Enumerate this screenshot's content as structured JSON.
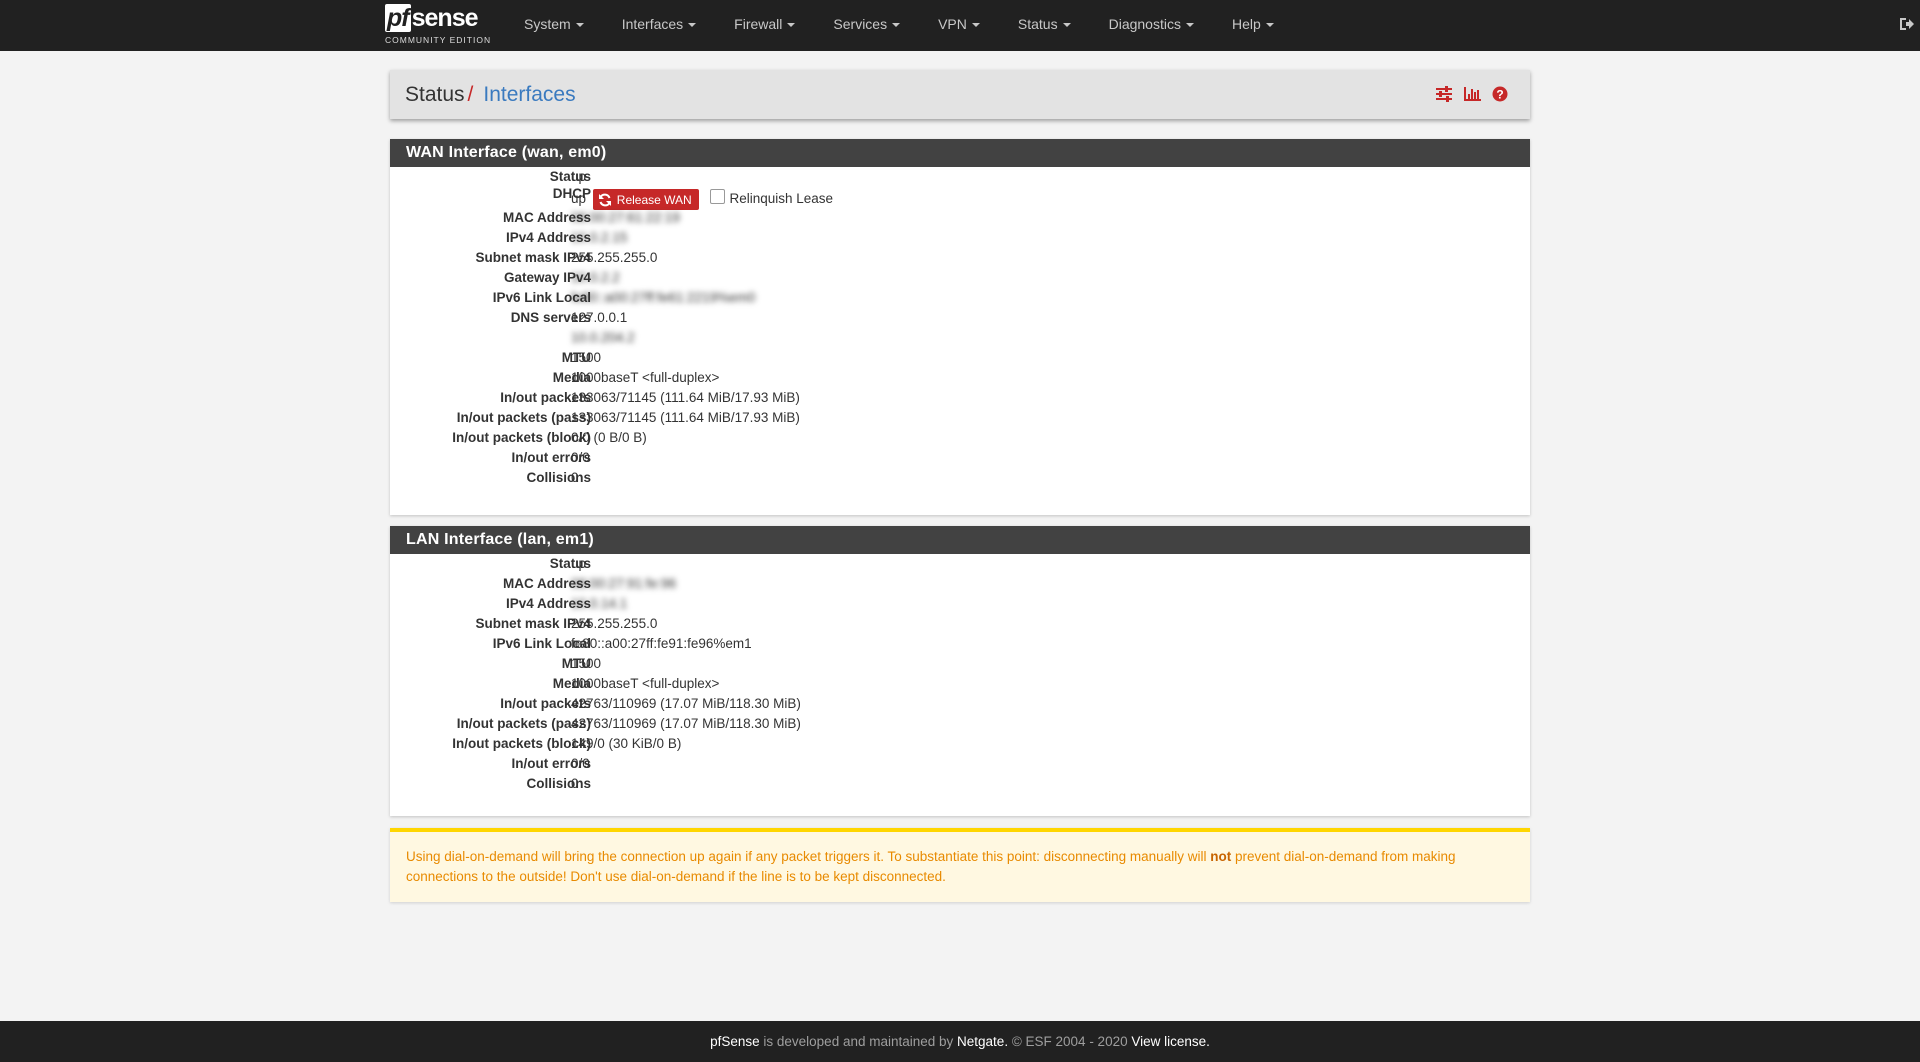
{
  "navbar": {
    "brand": {
      "logo_pf": "pf",
      "logo_sense": "sense",
      "edition": "COMMUNITY EDITION"
    },
    "menu": [
      "System",
      "Interfaces",
      "Firewall",
      "Services",
      "VPN",
      "Status",
      "Diagnostics",
      "Help"
    ]
  },
  "header": {
    "section": "Status",
    "separator": "/",
    "page": "Interfaces"
  },
  "wan": {
    "title": "WAN Interface (wan, em0)",
    "rows": [
      {
        "key": "Status",
        "value": "up"
      },
      {
        "key": "DHCP",
        "value": "up"
      },
      {
        "key": "MAC Address",
        "value": "08:00:27:61:22:19"
      },
      {
        "key": "IPv4 Address",
        "value": "10.0.2.15"
      },
      {
        "key": "Subnet mask IPv4",
        "value": "255.255.255.0"
      },
      {
        "key": "Gateway IPv4",
        "value": "10.0.2.2"
      },
      {
        "key": "IPv6 Link Local",
        "value": "fe80::a00:27ff:fe61:2219%em0"
      },
      {
        "key": "DNS servers",
        "value": "127.0.0.1"
      },
      {
        "key": "",
        "value": "10.0.204.2"
      },
      {
        "key": "MTU",
        "value": "1500"
      },
      {
        "key": "Media",
        "value": "1000baseT <full-duplex>"
      },
      {
        "key": "In/out packets",
        "value": "133063/71145 (111.64 MiB/17.93 MiB)"
      },
      {
        "key": "In/out packets (pass)",
        "value": "133063/71145 (111.64 MiB/17.93 MiB)"
      },
      {
        "key": "In/out packets (block)",
        "value": "0/0 (0 B/0 B)"
      },
      {
        "key": "In/out errors",
        "value": "0/0"
      },
      {
        "key": "Collisions",
        "value": "0"
      }
    ],
    "release_button": "Release WAN",
    "relinquish_label": "Relinquish Lease"
  },
  "lan": {
    "title": "LAN Interface (lan, em1)",
    "rows": [
      {
        "key": "Status",
        "value": "up"
      },
      {
        "key": "MAC Address",
        "value": "08:00:27:91:fe:96"
      },
      {
        "key": "IPv4 Address",
        "value": "10.0.14.1"
      },
      {
        "key": "Subnet mask IPv4",
        "value": "255.255.255.0"
      },
      {
        "key": "IPv6 Link Local",
        "value": "fe80::a00:27ff:fe91:fe96%em1"
      },
      {
        "key": "MTU",
        "value": "1500"
      },
      {
        "key": "Media",
        "value": "1000baseT <full-duplex>"
      },
      {
        "key": "In/out packets",
        "value": "42763/110969 (17.07 MiB/118.30 MiB)"
      },
      {
        "key": "In/out packets (pass)",
        "value": "42763/110969 (17.07 MiB/118.30 MiB)"
      },
      {
        "key": "In/out packets (block)",
        "value": "149/0 (30 KiB/0 B)"
      },
      {
        "key": "In/out errors",
        "value": "0/0"
      },
      {
        "key": "Collisions",
        "value": "0"
      }
    ]
  },
  "alert": {
    "part1": "Using dial-on-demand will bring the connection up again if any packet triggers it. To substantiate this point: disconnecting manually will ",
    "bold": "not",
    "part2": " prevent dial-on-demand from making connections to the outside! Don't use dial-on-demand if the line is to be kept disconnected."
  },
  "footer": {
    "brand": "pfSense",
    "text1": " is developed and maintained by ",
    "company": "Netgate.",
    "text2": " © ESF 2004 - 2020 ",
    "license": "View license."
  },
  "colors": {
    "navbar_bg": "#212121",
    "accent_red": "#c62828",
    "link_blue": "#3a7abf",
    "panel_heading": "#424242",
    "alert_text": "#e88a00",
    "alert_bg": "#fff8e1"
  }
}
